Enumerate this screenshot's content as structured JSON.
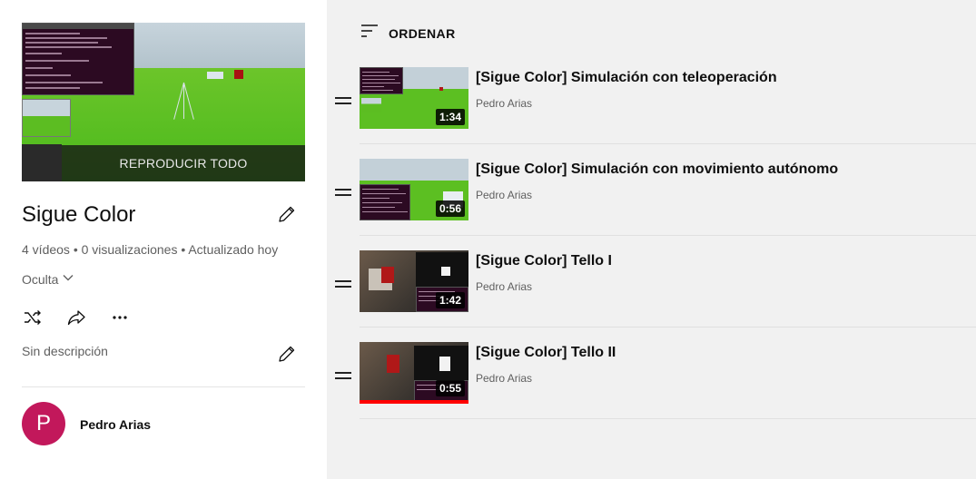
{
  "playlist": {
    "play_all": "REPRODUCIR TODO",
    "title": "Sigue Color",
    "meta": "4 vídeos • 0 visualizaciones • Actualizado hoy",
    "privacy": "Oculta",
    "description": "Sin descripción",
    "owner_initial": "P",
    "owner_name": "Pedro Arias",
    "colors": {
      "avatar": "#c2185b",
      "sidebar_bg": "#ffffff",
      "list_bg": "#f1f1f1"
    }
  },
  "list": {
    "sort_label": "ORDENAR",
    "videos": [
      {
        "title": "[Sigue Color] Simulación con teleoperación",
        "channel": "Pedro Arias",
        "duration": "1:34"
      },
      {
        "title": "[Sigue Color] Simulación con movimiento autónomo",
        "channel": "Pedro Arias",
        "duration": "0:56"
      },
      {
        "title": "[Sigue Color] Tello I",
        "channel": "Pedro Arias",
        "duration": "1:42"
      },
      {
        "title": "[Sigue Color] Tello II",
        "channel": "Pedro Arias",
        "duration": "0:55",
        "watched_fraction": 1.0
      }
    ]
  },
  "icons": [
    "edit-icon",
    "chevron-down-icon",
    "shuffle-icon",
    "share-icon",
    "more-icon",
    "sort-icon",
    "drag-handle-icon"
  ]
}
